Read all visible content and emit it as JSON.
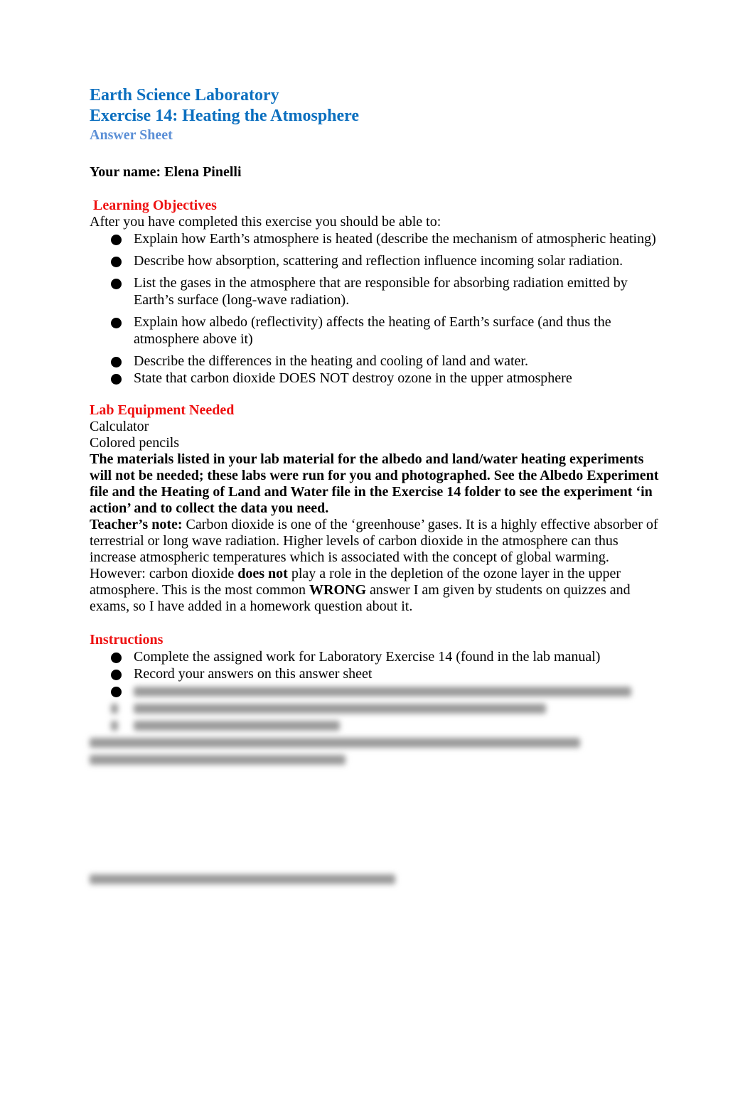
{
  "header": {
    "title_line1": "Earth Science Laboratory",
    "title_line2": "Exercise 14: Heating the Atmosphere",
    "subtitle": "Answer Sheet",
    "name_label": "Your name: Elena Pinelli"
  },
  "learning_objectives": {
    "heading": "Learning Objectives",
    "intro": "After you have completed this exercise you should be able to:",
    "items": [
      "Explain how Earth’s atmosphere is heated (describe the mechanism of atmospheric heating)",
      "Describe how absorption, scattering and reflection influence incoming solar radiation.",
      "List the gases in the atmosphere that are responsible for absorbing radiation emitted by Earth’s surface (long-wave radiation).",
      "Explain how albedo (reflectivity) affects the heating of Earth’s surface (and thus the atmosphere above it)",
      "Describe the differences in the heating and cooling of land and water.",
      "State that carbon dioxide DOES NOT destroy ozone in the upper atmosphere"
    ]
  },
  "lab_equipment": {
    "heading": "Lab Equipment Needed",
    "items": [
      "Calculator",
      "Colored pencils"
    ],
    "bold_note": "The materials listed in your lab material for the albedo and land/water heating experiments will not be needed; these labs were run for you and photographed. See the Albedo Experiment file and the Heating of Land and Water file in the Exercise 14 folder to see the experiment ‘in action’ and to collect the data you need.",
    "teacher_note": {
      "label": "Teacher’s note:",
      "text1": " Carbon dioxide is one of the ‘greenhouse’ gases. It is a highly effective absorber of terrestrial or long wave radiation. Higher levels of carbon dioxide in the atmosphere can thus increase atmospheric temperatures which is associated with the concept of global warming. However: carbon dioxide ",
      "emph1": "does not",
      "text2": " play a role in the depletion of the ozone layer in the upper atmosphere. This is the most common ",
      "emph2": "WRONG",
      "text3": " answer I am given by students on quizzes and exams, so I have added in a homework question about it."
    }
  },
  "instructions": {
    "heading": "Instructions",
    "items": [
      "Complete the assigned work for Laboratory Exercise 14 (found in the lab manual)",
      "Record your answers on this answer sheet"
    ],
    "obscured_note": "Remaining content is blurred / not legible"
  }
}
